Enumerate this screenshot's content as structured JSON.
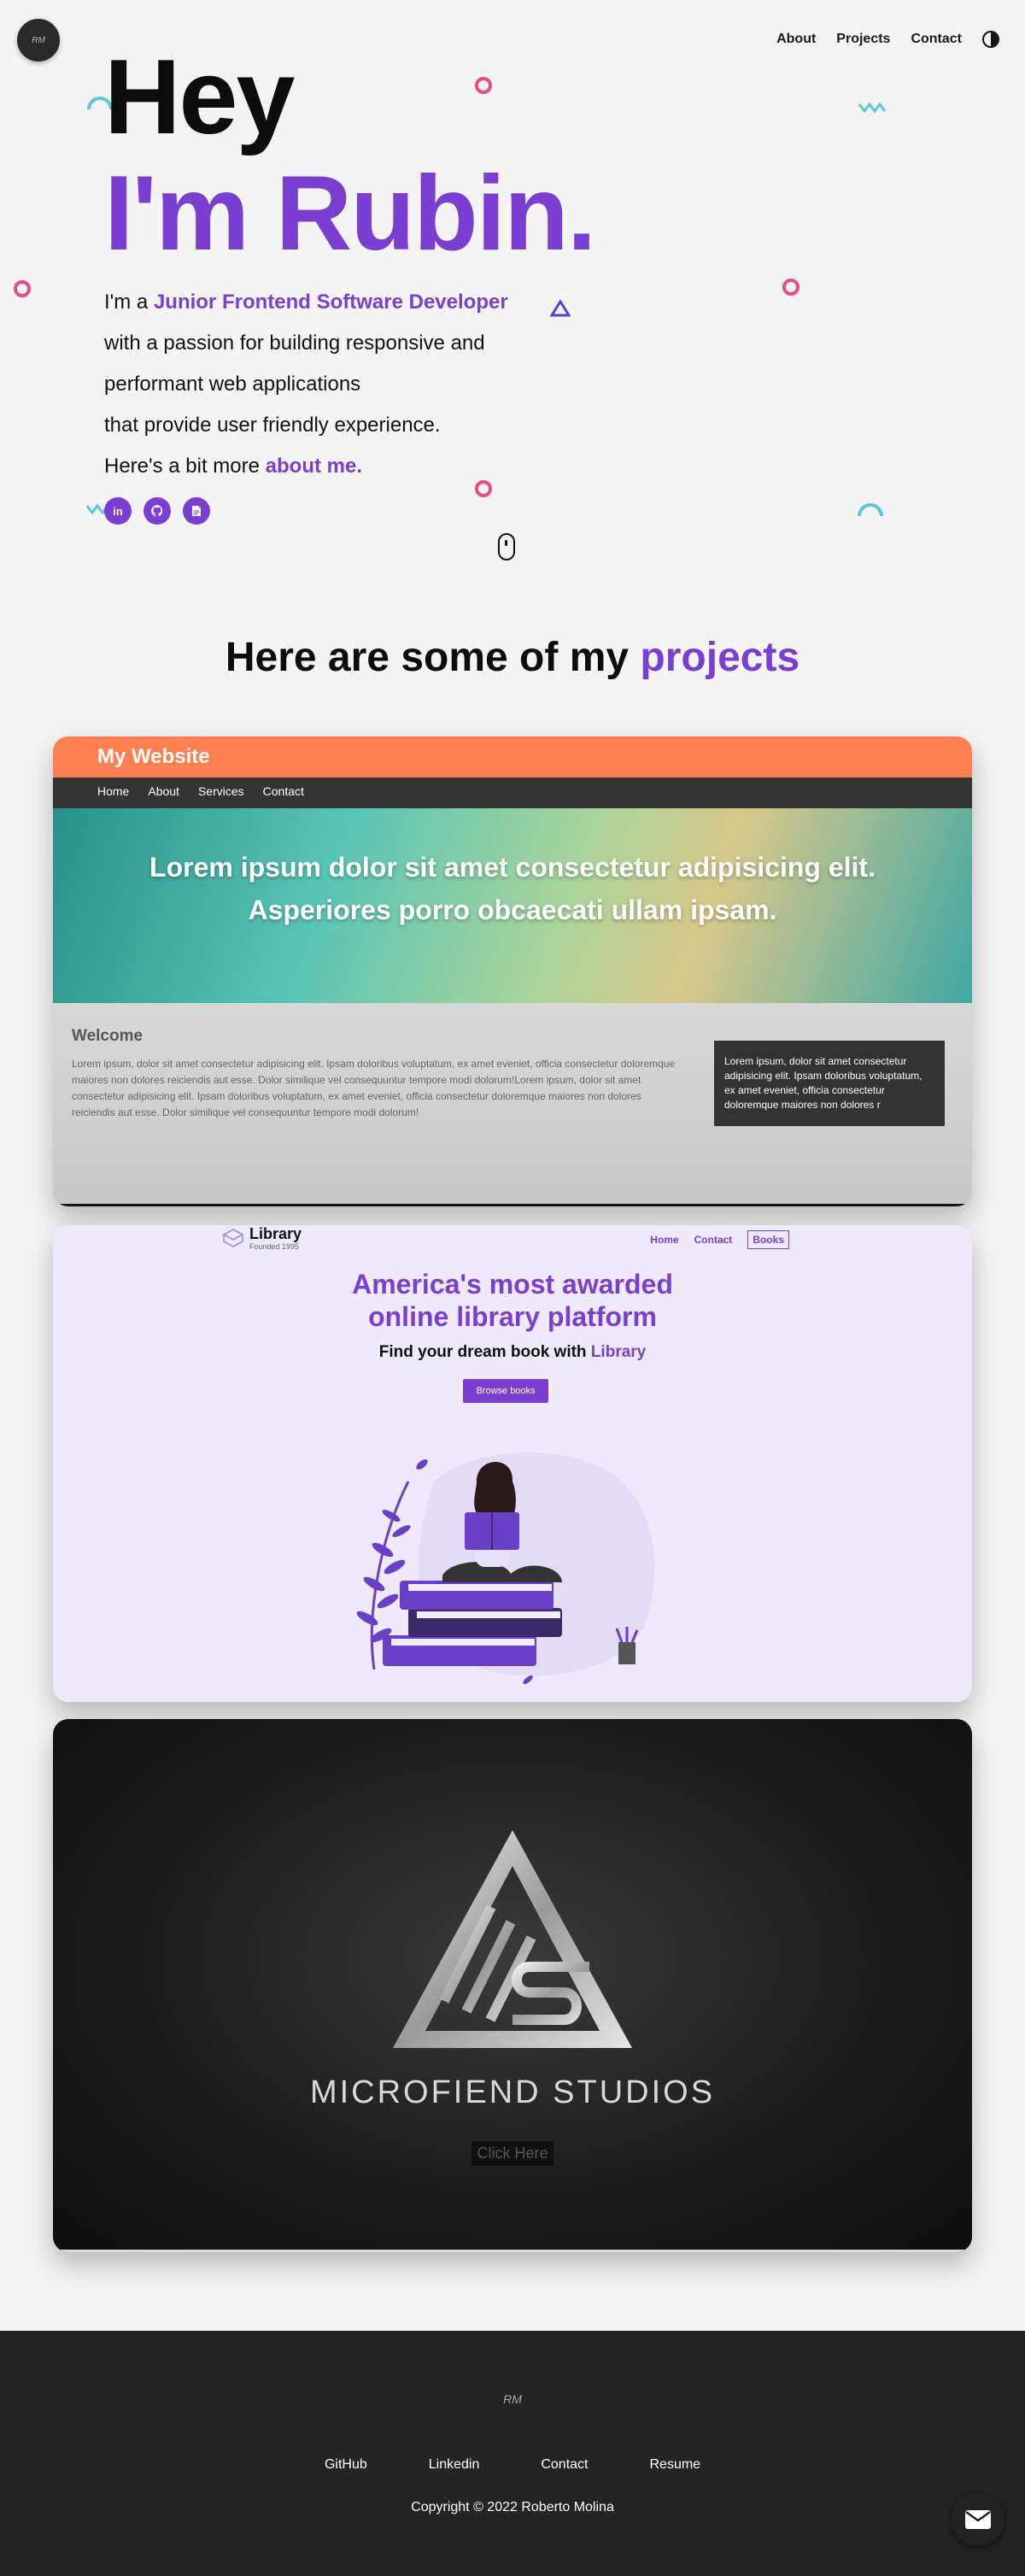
{
  "logo": {
    "text": "RM"
  },
  "nav": {
    "about": "About",
    "projects": "Projects",
    "contact": "Contact"
  },
  "hero": {
    "line1": "Hey",
    "line2": "I'm Rubin.",
    "intro": {
      "l1_prefix": "I'm a ",
      "l1_highlight": "Junior Frontend Software Developer",
      "l2": "with a passion for building responsive and",
      "l3": "performant web applications",
      "l4": "that provide user friendly experience.",
      "l5_prefix": "Here's a bit more ",
      "l5_link": "about me."
    },
    "socials": [
      {
        "name": "linkedin-icon",
        "glyph": "in"
      },
      {
        "name": "github-icon",
        "glyph": "⌾"
      },
      {
        "name": "resume-icon",
        "glyph": "▤"
      }
    ]
  },
  "projects_heading": {
    "prefix": "Here are some of my ",
    "highlight": "projects"
  },
  "project1": {
    "site_title": "My Website",
    "nav": [
      "Home",
      "About",
      "Services",
      "Contact"
    ],
    "banner_line1": "Lorem ipsum dolor sit amet consectetur adipisicing elit.",
    "banner_line2": "Asperiores porro obcaecati ullam ipsam.",
    "welcome": "Welcome",
    "body_text": "Lorem ipsum, dolor sit amet consectetur adipisicing elit. Ipsam doloribus voluptatum, ex amet eveniet, officia consectetur doloremque maiores non dolores reiciendis aut esse. Dolor similique vel consequuntur tempore modi dolorum!Lorem ipsum, dolor sit amet consectetur adipisicing elit. Ipsam doloribus voluptatum, ex amet eveniet, officia consectetur doloremque maiores non dolores reiciendis aut esse. Dolor similique vel consequuntur tempore modi dolorum!",
    "aside_text": "Lorem ipsum, dolor sit amet consectetur adipisicing elit. Ipsam doloribus voluptatum, ex amet eveniet, officia consectetur doloremque maiores non dolores r"
  },
  "project2": {
    "brand": "Library",
    "brand_sub": "Founded 1995",
    "nav": [
      "Home",
      "Contact",
      "Books"
    ],
    "title_l1": "America's most awarded",
    "title_l2": "online library platform",
    "sub_prefix": "Find your dream book with ",
    "sub_highlight": "Library",
    "button": "Browse books"
  },
  "project3": {
    "name": "MICROFIEND STUDIOS",
    "button": "Click Here"
  },
  "footer": {
    "logo": "RM",
    "links": [
      "GitHub",
      "Linkedin",
      "Contact",
      "Resume"
    ],
    "copyright": "Copyright © 2022 Roberto Molina"
  },
  "colors": {
    "accent": "#7a3fd0",
    "pink": "#e84a8a",
    "teal": "#5bc8d8",
    "footer": "#242424"
  }
}
